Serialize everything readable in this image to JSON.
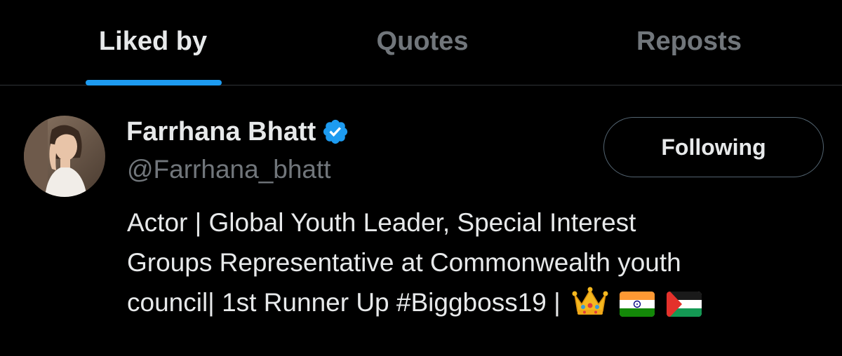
{
  "tabs": [
    {
      "label": "Liked by",
      "active": true
    },
    {
      "label": "Quotes",
      "active": false
    },
    {
      "label": "Reposts",
      "active": false
    }
  ],
  "user": {
    "name": "Farrhana Bhatt",
    "handle": "@Farrhana_bhatt",
    "verified": true,
    "avatar_icon": "profile-photo",
    "follow_label": "Following",
    "bio_lines": [
      "Actor | Global Youth Leader, Special Interest",
      "Groups Representative at Commonwealth youth",
      "council| 1st Runner Up #Biggboss19 |"
    ],
    "bio_emojis": [
      "crown-icon",
      "india-flag-icon",
      "palestine-flag-icon"
    ]
  },
  "colors": {
    "background": "#000000",
    "accent": "#1d9bf0",
    "text_primary": "#e7e9ea",
    "text_secondary": "#71767b",
    "divider": "#2f3336"
  }
}
